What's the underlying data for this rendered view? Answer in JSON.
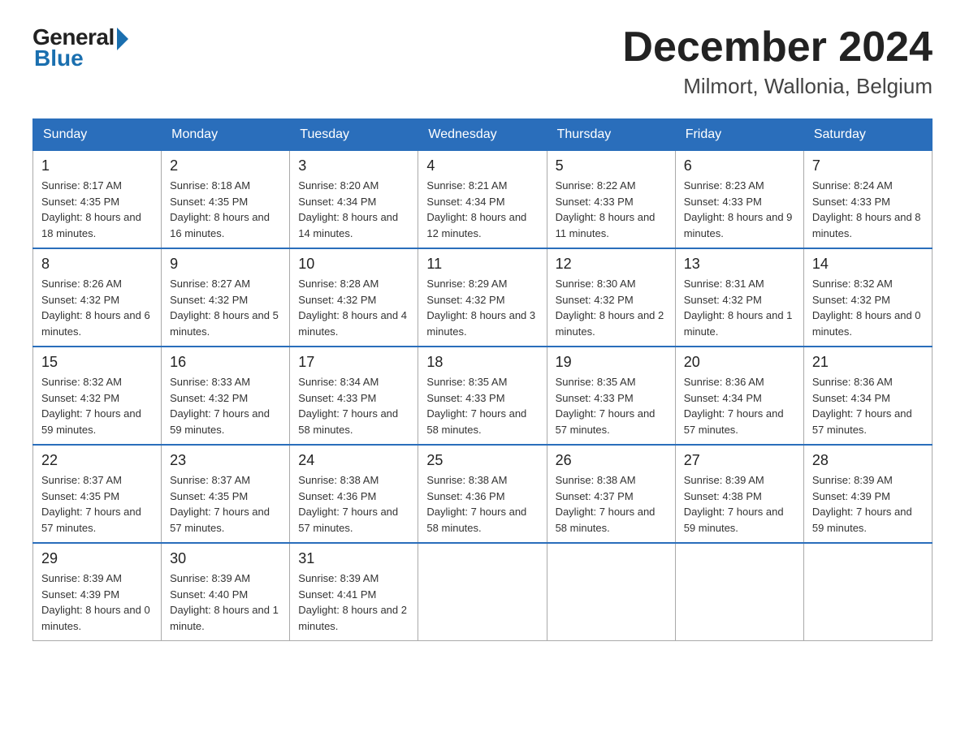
{
  "logo": {
    "general": "General",
    "blue": "Blue"
  },
  "header": {
    "month": "December 2024",
    "location": "Milmort, Wallonia, Belgium"
  },
  "weekdays": [
    "Sunday",
    "Monday",
    "Tuesday",
    "Wednesday",
    "Thursday",
    "Friday",
    "Saturday"
  ],
  "weeks": [
    [
      {
        "day": "1",
        "sunrise": "8:17 AM",
        "sunset": "4:35 PM",
        "daylight": "8 hours and 18 minutes."
      },
      {
        "day": "2",
        "sunrise": "8:18 AM",
        "sunset": "4:35 PM",
        "daylight": "8 hours and 16 minutes."
      },
      {
        "day": "3",
        "sunrise": "8:20 AM",
        "sunset": "4:34 PM",
        "daylight": "8 hours and 14 minutes."
      },
      {
        "day": "4",
        "sunrise": "8:21 AM",
        "sunset": "4:34 PM",
        "daylight": "8 hours and 12 minutes."
      },
      {
        "day": "5",
        "sunrise": "8:22 AM",
        "sunset": "4:33 PM",
        "daylight": "8 hours and 11 minutes."
      },
      {
        "day": "6",
        "sunrise": "8:23 AM",
        "sunset": "4:33 PM",
        "daylight": "8 hours and 9 minutes."
      },
      {
        "day": "7",
        "sunrise": "8:24 AM",
        "sunset": "4:33 PM",
        "daylight": "8 hours and 8 minutes."
      }
    ],
    [
      {
        "day": "8",
        "sunrise": "8:26 AM",
        "sunset": "4:32 PM",
        "daylight": "8 hours and 6 minutes."
      },
      {
        "day": "9",
        "sunrise": "8:27 AM",
        "sunset": "4:32 PM",
        "daylight": "8 hours and 5 minutes."
      },
      {
        "day": "10",
        "sunrise": "8:28 AM",
        "sunset": "4:32 PM",
        "daylight": "8 hours and 4 minutes."
      },
      {
        "day": "11",
        "sunrise": "8:29 AM",
        "sunset": "4:32 PM",
        "daylight": "8 hours and 3 minutes."
      },
      {
        "day": "12",
        "sunrise": "8:30 AM",
        "sunset": "4:32 PM",
        "daylight": "8 hours and 2 minutes."
      },
      {
        "day": "13",
        "sunrise": "8:31 AM",
        "sunset": "4:32 PM",
        "daylight": "8 hours and 1 minute."
      },
      {
        "day": "14",
        "sunrise": "8:32 AM",
        "sunset": "4:32 PM",
        "daylight": "8 hours and 0 minutes."
      }
    ],
    [
      {
        "day": "15",
        "sunrise": "8:32 AM",
        "sunset": "4:32 PM",
        "daylight": "7 hours and 59 minutes."
      },
      {
        "day": "16",
        "sunrise": "8:33 AM",
        "sunset": "4:32 PM",
        "daylight": "7 hours and 59 minutes."
      },
      {
        "day": "17",
        "sunrise": "8:34 AM",
        "sunset": "4:33 PM",
        "daylight": "7 hours and 58 minutes."
      },
      {
        "day": "18",
        "sunrise": "8:35 AM",
        "sunset": "4:33 PM",
        "daylight": "7 hours and 58 minutes."
      },
      {
        "day": "19",
        "sunrise": "8:35 AM",
        "sunset": "4:33 PM",
        "daylight": "7 hours and 57 minutes."
      },
      {
        "day": "20",
        "sunrise": "8:36 AM",
        "sunset": "4:34 PM",
        "daylight": "7 hours and 57 minutes."
      },
      {
        "day": "21",
        "sunrise": "8:36 AM",
        "sunset": "4:34 PM",
        "daylight": "7 hours and 57 minutes."
      }
    ],
    [
      {
        "day": "22",
        "sunrise": "8:37 AM",
        "sunset": "4:35 PM",
        "daylight": "7 hours and 57 minutes."
      },
      {
        "day": "23",
        "sunrise": "8:37 AM",
        "sunset": "4:35 PM",
        "daylight": "7 hours and 57 minutes."
      },
      {
        "day": "24",
        "sunrise": "8:38 AM",
        "sunset": "4:36 PM",
        "daylight": "7 hours and 57 minutes."
      },
      {
        "day": "25",
        "sunrise": "8:38 AM",
        "sunset": "4:36 PM",
        "daylight": "7 hours and 58 minutes."
      },
      {
        "day": "26",
        "sunrise": "8:38 AM",
        "sunset": "4:37 PM",
        "daylight": "7 hours and 58 minutes."
      },
      {
        "day": "27",
        "sunrise": "8:39 AM",
        "sunset": "4:38 PM",
        "daylight": "7 hours and 59 minutes."
      },
      {
        "day": "28",
        "sunrise": "8:39 AM",
        "sunset": "4:39 PM",
        "daylight": "7 hours and 59 minutes."
      }
    ],
    [
      {
        "day": "29",
        "sunrise": "8:39 AM",
        "sunset": "4:39 PM",
        "daylight": "8 hours and 0 minutes."
      },
      {
        "day": "30",
        "sunrise": "8:39 AM",
        "sunset": "4:40 PM",
        "daylight": "8 hours and 1 minute."
      },
      {
        "day": "31",
        "sunrise": "8:39 AM",
        "sunset": "4:41 PM",
        "daylight": "8 hours and 2 minutes."
      },
      null,
      null,
      null,
      null
    ]
  ]
}
